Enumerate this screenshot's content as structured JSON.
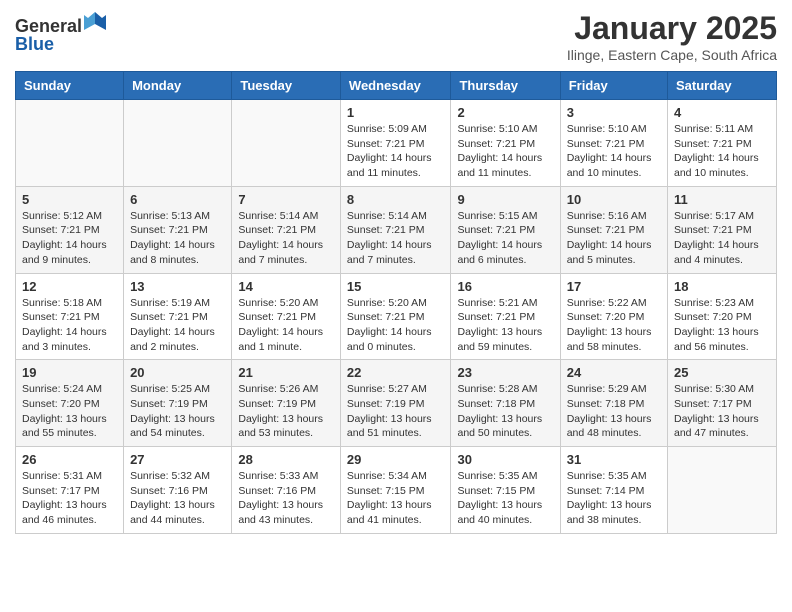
{
  "header": {
    "logo": {
      "general": "General",
      "blue": "Blue"
    },
    "title": "January 2025",
    "location": "Ilinge, Eastern Cape, South Africa"
  },
  "weekdays": [
    "Sunday",
    "Monday",
    "Tuesday",
    "Wednesday",
    "Thursday",
    "Friday",
    "Saturday"
  ],
  "weeks": [
    [
      {
        "day": "",
        "info": ""
      },
      {
        "day": "",
        "info": ""
      },
      {
        "day": "",
        "info": ""
      },
      {
        "day": "1",
        "info": "Sunrise: 5:09 AM\nSunset: 7:21 PM\nDaylight: 14 hours and 11 minutes."
      },
      {
        "day": "2",
        "info": "Sunrise: 5:10 AM\nSunset: 7:21 PM\nDaylight: 14 hours and 11 minutes."
      },
      {
        "day": "3",
        "info": "Sunrise: 5:10 AM\nSunset: 7:21 PM\nDaylight: 14 hours and 10 minutes."
      },
      {
        "day": "4",
        "info": "Sunrise: 5:11 AM\nSunset: 7:21 PM\nDaylight: 14 hours and 10 minutes."
      }
    ],
    [
      {
        "day": "5",
        "info": "Sunrise: 5:12 AM\nSunset: 7:21 PM\nDaylight: 14 hours and 9 minutes."
      },
      {
        "day": "6",
        "info": "Sunrise: 5:13 AM\nSunset: 7:21 PM\nDaylight: 14 hours and 8 minutes."
      },
      {
        "day": "7",
        "info": "Sunrise: 5:14 AM\nSunset: 7:21 PM\nDaylight: 14 hours and 7 minutes."
      },
      {
        "day": "8",
        "info": "Sunrise: 5:14 AM\nSunset: 7:21 PM\nDaylight: 14 hours and 7 minutes."
      },
      {
        "day": "9",
        "info": "Sunrise: 5:15 AM\nSunset: 7:21 PM\nDaylight: 14 hours and 6 minutes."
      },
      {
        "day": "10",
        "info": "Sunrise: 5:16 AM\nSunset: 7:21 PM\nDaylight: 14 hours and 5 minutes."
      },
      {
        "day": "11",
        "info": "Sunrise: 5:17 AM\nSunset: 7:21 PM\nDaylight: 14 hours and 4 minutes."
      }
    ],
    [
      {
        "day": "12",
        "info": "Sunrise: 5:18 AM\nSunset: 7:21 PM\nDaylight: 14 hours and 3 minutes."
      },
      {
        "day": "13",
        "info": "Sunrise: 5:19 AM\nSunset: 7:21 PM\nDaylight: 14 hours and 2 minutes."
      },
      {
        "day": "14",
        "info": "Sunrise: 5:20 AM\nSunset: 7:21 PM\nDaylight: 14 hours and 1 minute."
      },
      {
        "day": "15",
        "info": "Sunrise: 5:20 AM\nSunset: 7:21 PM\nDaylight: 14 hours and 0 minutes."
      },
      {
        "day": "16",
        "info": "Sunrise: 5:21 AM\nSunset: 7:21 PM\nDaylight: 13 hours and 59 minutes."
      },
      {
        "day": "17",
        "info": "Sunrise: 5:22 AM\nSunset: 7:20 PM\nDaylight: 13 hours and 58 minutes."
      },
      {
        "day": "18",
        "info": "Sunrise: 5:23 AM\nSunset: 7:20 PM\nDaylight: 13 hours and 56 minutes."
      }
    ],
    [
      {
        "day": "19",
        "info": "Sunrise: 5:24 AM\nSunset: 7:20 PM\nDaylight: 13 hours and 55 minutes."
      },
      {
        "day": "20",
        "info": "Sunrise: 5:25 AM\nSunset: 7:19 PM\nDaylight: 13 hours and 54 minutes."
      },
      {
        "day": "21",
        "info": "Sunrise: 5:26 AM\nSunset: 7:19 PM\nDaylight: 13 hours and 53 minutes."
      },
      {
        "day": "22",
        "info": "Sunrise: 5:27 AM\nSunset: 7:19 PM\nDaylight: 13 hours and 51 minutes."
      },
      {
        "day": "23",
        "info": "Sunrise: 5:28 AM\nSunset: 7:18 PM\nDaylight: 13 hours and 50 minutes."
      },
      {
        "day": "24",
        "info": "Sunrise: 5:29 AM\nSunset: 7:18 PM\nDaylight: 13 hours and 48 minutes."
      },
      {
        "day": "25",
        "info": "Sunrise: 5:30 AM\nSunset: 7:17 PM\nDaylight: 13 hours and 47 minutes."
      }
    ],
    [
      {
        "day": "26",
        "info": "Sunrise: 5:31 AM\nSunset: 7:17 PM\nDaylight: 13 hours and 46 minutes."
      },
      {
        "day": "27",
        "info": "Sunrise: 5:32 AM\nSunset: 7:16 PM\nDaylight: 13 hours and 44 minutes."
      },
      {
        "day": "28",
        "info": "Sunrise: 5:33 AM\nSunset: 7:16 PM\nDaylight: 13 hours and 43 minutes."
      },
      {
        "day": "29",
        "info": "Sunrise: 5:34 AM\nSunset: 7:15 PM\nDaylight: 13 hours and 41 minutes."
      },
      {
        "day": "30",
        "info": "Sunrise: 5:35 AM\nSunset: 7:15 PM\nDaylight: 13 hours and 40 minutes."
      },
      {
        "day": "31",
        "info": "Sunrise: 5:35 AM\nSunset: 7:14 PM\nDaylight: 13 hours and 38 minutes."
      },
      {
        "day": "",
        "info": ""
      }
    ]
  ]
}
